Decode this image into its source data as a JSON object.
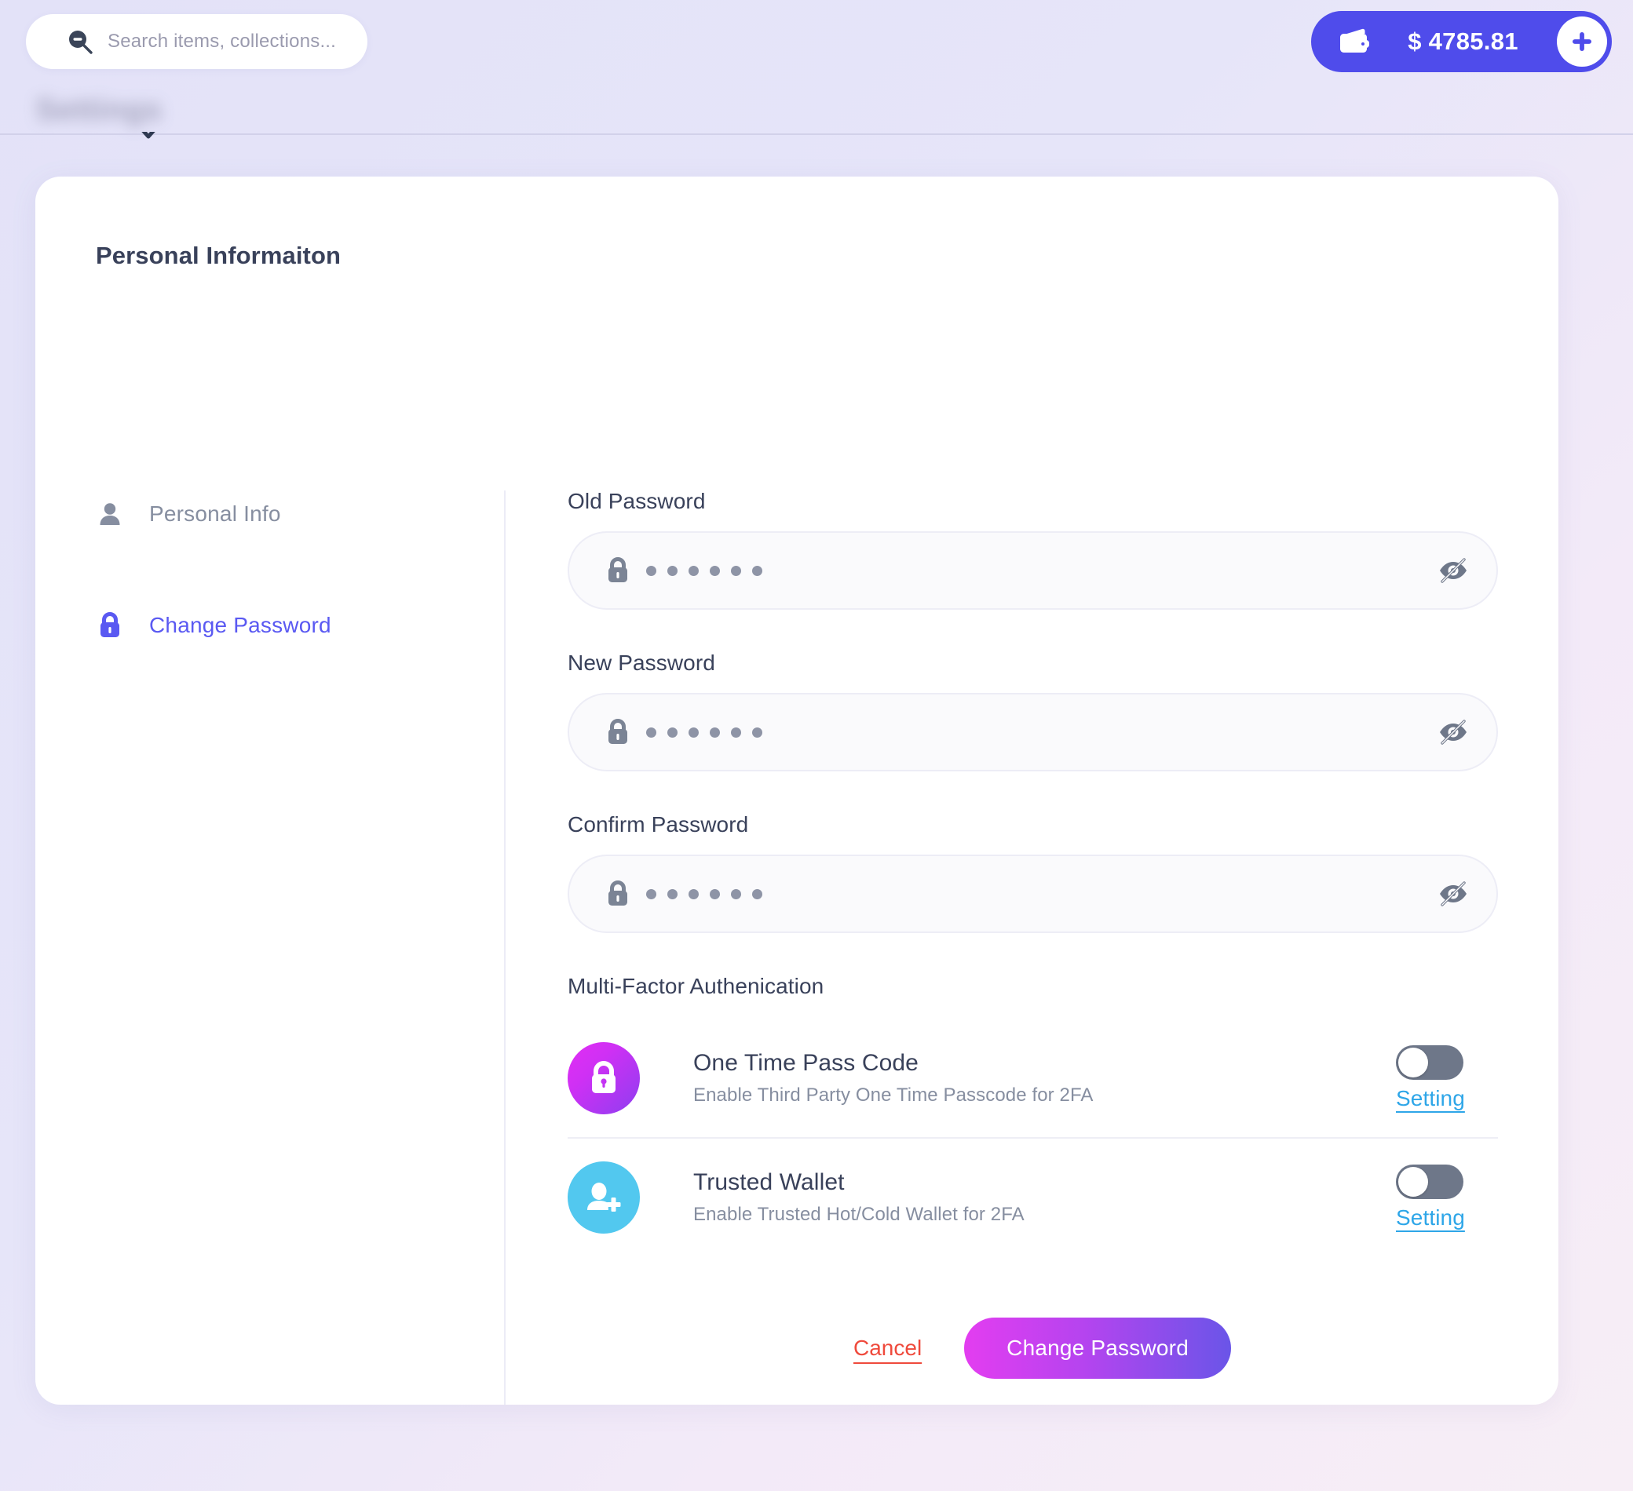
{
  "topbar": {
    "search": {
      "placeholder": "Search items, collections...",
      "icon": "search-zoom-out-icon"
    },
    "wallet": {
      "icon": "wallet-icon",
      "balance": "$ 4785.81",
      "add_icon": "plus-icon"
    }
  },
  "background": {
    "page_title": "Settings"
  },
  "card": {
    "title": "Personal Informaiton",
    "nav": {
      "items": [
        {
          "label": "Personal Info",
          "icon": "person-icon",
          "active": false
        },
        {
          "label": "Change Password",
          "icon": "lock-icon",
          "active": true
        }
      ]
    },
    "form": {
      "fields": [
        {
          "label": "Old Password",
          "value": "••••••",
          "dots": 6,
          "lock_icon": "lock-icon",
          "eye_icon": "eye-off-icon"
        },
        {
          "label": "New Password",
          "value": "••••••",
          "dots": 6,
          "lock_icon": "lock-icon",
          "eye_icon": "eye-off-icon"
        },
        {
          "label": "Confirm Password",
          "value": "••••••",
          "dots": 6,
          "lock_icon": "lock-icon",
          "eye_icon": "eye-off-icon"
        }
      ],
      "mfa": {
        "title": "Multi-Factor Authenication",
        "rows": [
          {
            "name": "One Time Pass Code",
            "description": "Enable Third Party One Time Passcode for 2FA",
            "icon": "lock-badge-icon",
            "toggle_on": false,
            "setting_label": "Setting"
          },
          {
            "name": "Trusted Wallet",
            "description": "Enable Trusted Hot/Cold Wallet for 2FA",
            "icon": "user-plus-badge-icon",
            "toggle_on": false,
            "setting_label": "Setting"
          }
        ]
      },
      "actions": {
        "cancel_label": "Cancel",
        "submit_label": "Change Password"
      }
    }
  },
  "colors": {
    "accent_indigo": "#4f4ceb",
    "active_nav": "#5a59f2",
    "setting_link": "#2ea6e8",
    "cancel_red": "#ef4a3c",
    "badge_otp_from": "#e22ef5",
    "badge_otp_to": "#8e3ef0",
    "badge_wallet": "#52c8ef",
    "submit_from": "#e33df0",
    "submit_to": "#6a55e8",
    "page_bg": "#e3e2f8",
    "text_dark": "#39415a",
    "text_muted": "#868ea0"
  }
}
